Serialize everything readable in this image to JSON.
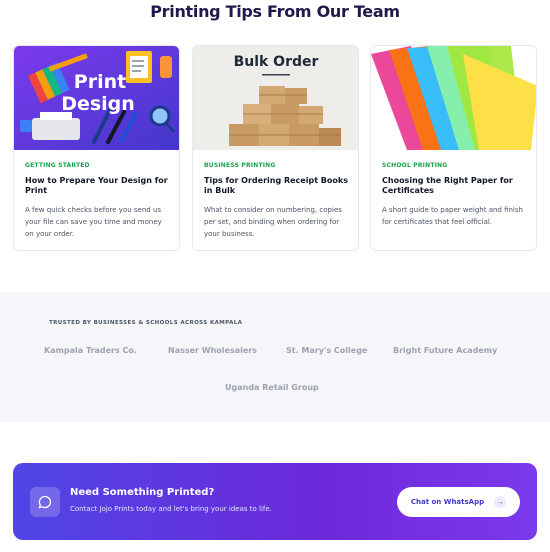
{
  "section": {
    "title": "Printing Tips From Our Team"
  },
  "cards": [
    {
      "tag": "GETTING STARTED",
      "title": "How to Prepare Your Design for Print",
      "description": "A few quick checks before you send us your file can save you time and money on your order.",
      "image": {
        "line1": "Print",
        "line2": "Design"
      }
    },
    {
      "tag": "BUSINESS PRINTING",
      "title": "Tips for Ordering Receipt Books in Bulk",
      "description": "What to consider on numbering, copies per set, and binding when ordering for your business.",
      "image": {
        "heading": "Bulk Order"
      }
    },
    {
      "tag": "SCHOOL PRINTING",
      "title": "Choosing the Right Paper for Certificates",
      "description": "A short guide to paper weight and finish for certificates that feel official.",
      "image": {}
    }
  ],
  "trusted": {
    "label": "TRUSTED BY BUSINESSES & SCHOOLS ACROSS KAMPALA",
    "partners": [
      "Kampala Traders Co.",
      "Nasser Wholesalers",
      "St. Mary's College",
      "Bright Future Academy",
      "Uganda Retail Group"
    ]
  },
  "cta": {
    "heading": "Need Something Printed?",
    "subtext": "Contact Jojo Prints today and let's bring your ideas to life.",
    "button_label": "Chat on WhatsApp",
    "icons": {
      "chat": "chat-bubble-icon",
      "arrow": "arrow-right-icon"
    }
  },
  "colors": {
    "tag": "#16a34a",
    "cta_start": "#4f46e5",
    "cta_end": "#7c3aed"
  }
}
